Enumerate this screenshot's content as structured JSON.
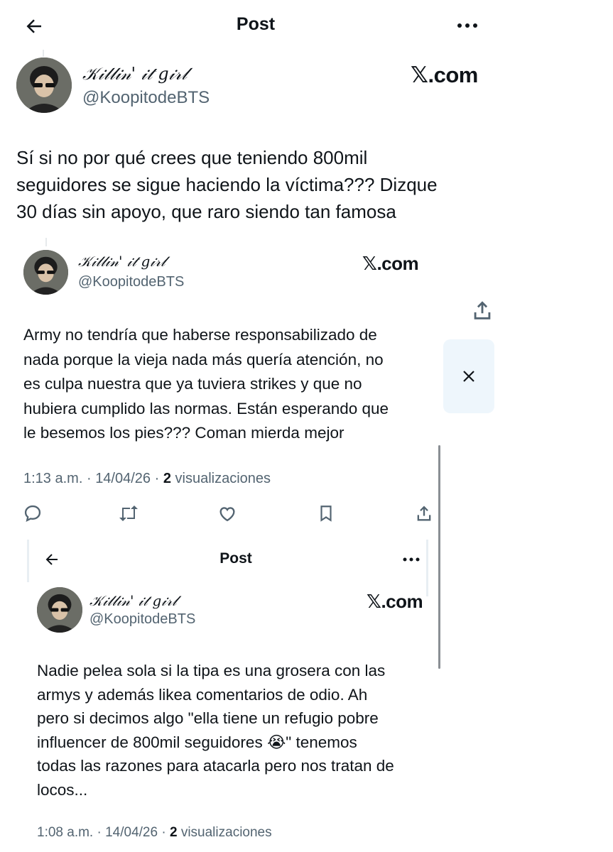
{
  "outer": {
    "header": {
      "title": "Post"
    },
    "author": {
      "display_name": "𝒦𝒾𝓁𝓁𝒾𝓃' 𝒾𝓉 𝑔𝒾𝓇𝓁",
      "handle": "@KoopitodeBTS"
    },
    "source": "𝕏.com",
    "body": "Sí si no por qué crees que teniendo 800mil\nseguidores se sigue haciendo la víctima??? Dizque\n30 días sin apoyo, que raro siendo tan famosa"
  },
  "middle": {
    "author": {
      "display_name": "𝒦𝒾𝓁𝓁𝒾𝓃' 𝒾𝓉 𝑔𝒾𝓇𝓁",
      "handle": "@KoopitodeBTS"
    },
    "source": "𝕏.com",
    "body": "Army no tendría que haberse responsabilizado de\nnada porque la vieja nada más quería atención, no\nes culpa nuestra que ya tuviera strikes y que no\nhubiera cumplido las normas. Están esperando que\nle besemos los pies??? Coman mierda mejor",
    "meta": {
      "time": "1:13 a.m.",
      "date": "14/04/26",
      "views_count": "2",
      "views_label": "visualizaciones",
      "separator": "·"
    }
  },
  "inner": {
    "header": {
      "title": "Post"
    },
    "author": {
      "display_name": "𝒦𝒾𝓁𝓁𝒾𝓃' 𝒾𝓉 𝑔𝒾𝓇𝓁",
      "handle": "@KoopitodeBTS"
    },
    "source": "𝕏.com",
    "body": "Nadie pelea sola si la tipa es una grosera con las\narmys y además likea comentarios de odio. Ah\npero si decimos algo \"ella tiene un refugio pobre\ninfluencer de 800mil seguidores 😭\" tenemos\ntodas las razones para atacarla pero nos tratan de\nlocos...",
    "meta": {
      "time": "1:08 a.m.",
      "date": "14/04/26",
      "views_count": "2",
      "views_label": "visualizaciones",
      "separator": "·"
    }
  },
  "icons": {
    "back": "back-arrow-icon",
    "more": "more-icon",
    "share": "share-icon",
    "close": "close-icon",
    "reply": "reply-icon",
    "repost": "repost-icon",
    "like": "like-icon",
    "bookmark": "bookmark-icon"
  }
}
